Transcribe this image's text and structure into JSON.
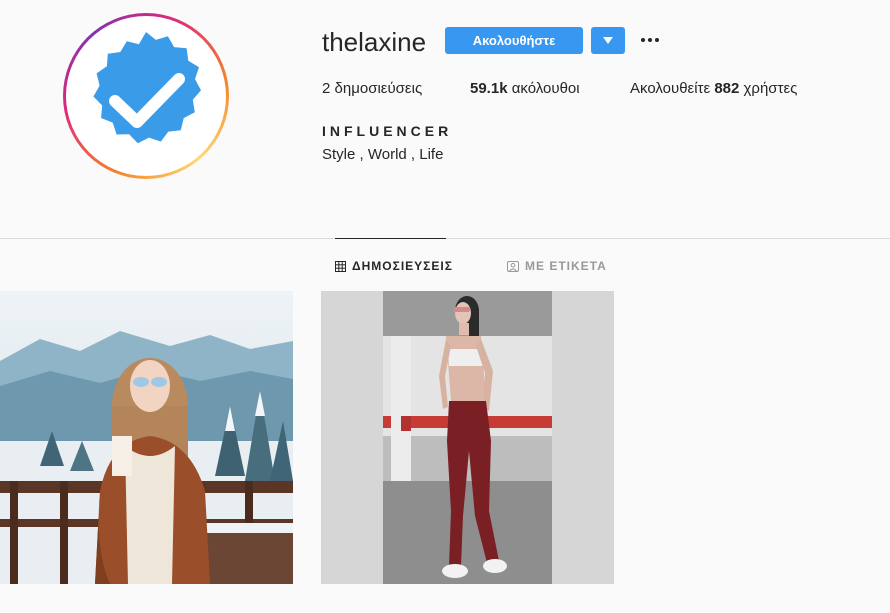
{
  "profile": {
    "username": "thelaxine",
    "follow_label": "Ακολουθήστε",
    "dropdown_icon": "caret-down-icon",
    "more_icon": "more-dots-icon",
    "avatar_icon": "verified-badge-icon",
    "avatar_color": "#3897f0",
    "stats": {
      "posts_count": "2",
      "posts_label": "δημοσιεύσεις",
      "followers_count": "59.1k",
      "followers_label": "ακόλουθοι",
      "following_prefix": "Ακολουθείτε",
      "following_count": "882",
      "following_suffix": "χρήστες"
    },
    "bio_name": "INFLUENCER",
    "bio_text": "Style , World , Life"
  },
  "tabs": [
    {
      "label": "ΔΗΜΟΣΙΕΥΣΕΙΣ",
      "icon": "grid-icon",
      "active": true
    },
    {
      "label": "ΜΕ ΕΤΙΚΕΤΑ",
      "icon": "tagged-icon",
      "active": false
    }
  ],
  "colors": {
    "accent": "#3897f0",
    "text": "#262626",
    "muted": "#999999",
    "background": "#fafafa"
  }
}
